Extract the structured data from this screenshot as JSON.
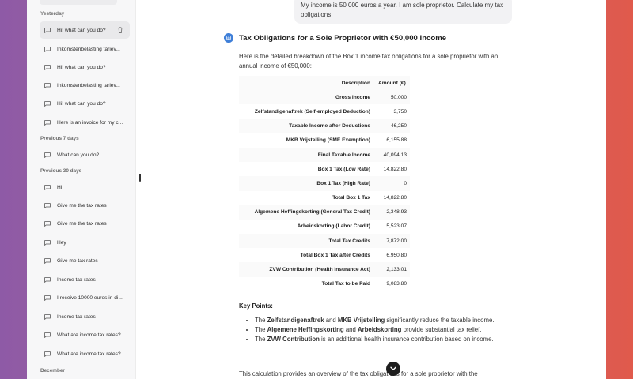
{
  "sidebar": {
    "groups": [
      {
        "label": "Yesterday"
      },
      {
        "label": "Previous 7 days"
      },
      {
        "label": "Previous 30 days"
      },
      {
        "label": "December"
      }
    ],
    "items": [
      {
        "label": "Hi! what can you do?"
      },
      {
        "label": "Inkomstenbelasting tariev..."
      },
      {
        "label": "Hi! what can you do?"
      },
      {
        "label": "Inkomstenbelasting tariev..."
      },
      {
        "label": "Hi! what can you do?"
      },
      {
        "label": "Here is an invoice for my c..."
      },
      {
        "label": "What can you do?"
      },
      {
        "label": "Hi"
      },
      {
        "label": "Give me the tax rates"
      },
      {
        "label": "Give me the tax rates"
      },
      {
        "label": "Hey"
      },
      {
        "label": "Give me tax rates"
      },
      {
        "label": "Income tax rates"
      },
      {
        "label": "I receive 10000 euros in di..."
      },
      {
        "label": "Income tax rates"
      },
      {
        "label": "What are income tax rates?"
      },
      {
        "label": "What are income tax rates?"
      }
    ]
  },
  "chat": {
    "user_message": "My income is 50 000 euros a year. I am sole proprietor. Calculate my tax obligations",
    "response_title": "Tax Obligations for a Sole Proprietor with €50,000 Income",
    "intro": "Here is the detailed breakdown of the Box 1 income tax obligations for a sole proprietor with an annual income of €50,000:",
    "table": {
      "headers": [
        "Description",
        "Amount (€)"
      ],
      "rows": [
        [
          "Gross Income",
          "50,000"
        ],
        [
          "Zelfstandigenaftrek (Self-employed Deduction)",
          "3,750"
        ],
        [
          "Taxable Income after Deductions",
          "46,250"
        ],
        [
          "MKB Vrijstelling (SME Exemption)",
          "6,155.88"
        ],
        [
          "Final Taxable Income",
          "40,094.13"
        ],
        [
          "Box 1 Tax (Low Rate)",
          "14,822.80"
        ],
        [
          "Box 1 Tax (High Rate)",
          "0"
        ],
        [
          "Total Box 1 Tax",
          "14,822.80"
        ],
        [
          "Algemene Heffingskorting (General Tax Credit)",
          "2,348.93"
        ],
        [
          "Arbeidskorting (Labor Credit)",
          "5,523.07"
        ],
        [
          "Total Tax Credits",
          "7,872.00"
        ],
        [
          "Total Box 1 Tax after Credits",
          "6,950.80"
        ],
        [
          "ZVW Contribution (Health Insurance Act)",
          "2,133.01"
        ],
        [
          "Total Tax to be Paid",
          "9,083.80"
        ]
      ]
    },
    "key_points_title": "Key Points:",
    "key_points": [
      {
        "pre": "The ",
        "b1": "Zelfstandigenaftrek",
        "mid": " and ",
        "b2": "MKB Vrijstelling",
        "post": " significantly reduce the taxable income."
      },
      {
        "pre": "The ",
        "b1": "Algemene Heffingskorting",
        "mid": " and ",
        "b2": "Arbeidskorting",
        "post": " provide substantial tax relief."
      },
      {
        "pre": "The ",
        "b1": "ZVW Contribution",
        "mid": "",
        "b2": "",
        "post": " is an additional health insurance contribution based on income."
      }
    ],
    "conclusion": "This calculation provides an overview of the tax obligations for a sole proprietor with the"
  },
  "icons": {
    "chat": "chat-bubble-icon",
    "trash": "trash-icon",
    "avatar": "assistant-avatar-icon",
    "scroll": "chevron-down-icon"
  },
  "colors": {
    "accent": "#3f7fd8",
    "scroll_button": "#1e1e1e",
    "active_item": "#e9e9eb"
  }
}
